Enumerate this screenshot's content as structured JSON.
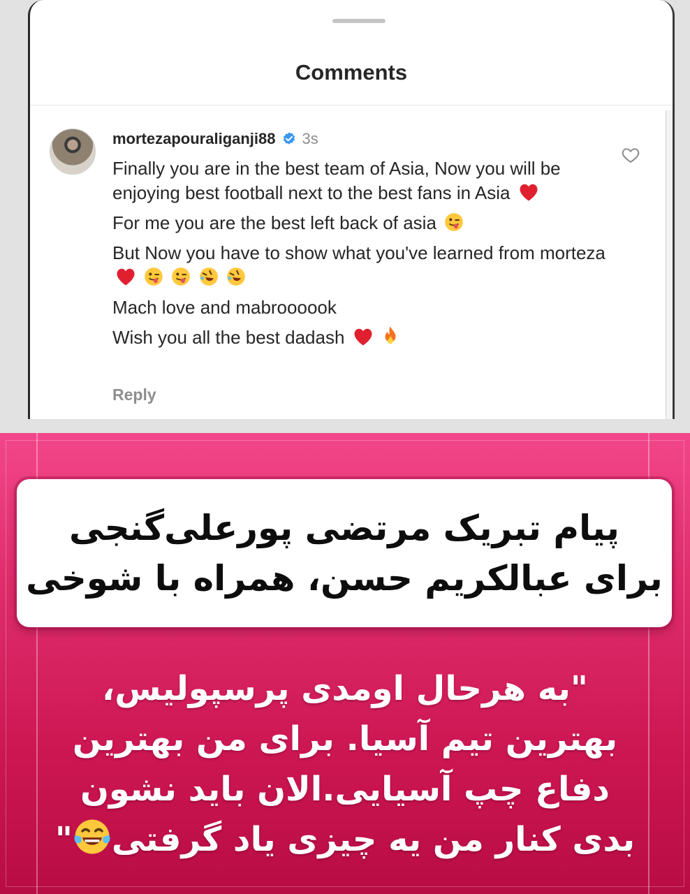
{
  "sheet": {
    "title": "Comments"
  },
  "comment": {
    "username": "mortezapouraliganji88",
    "time": "3s",
    "paragraphs": [
      "Finally you are in the best team of Asia, Now you will be enjoying best football next to the best fans in Asia",
      "For me you are the best left back of asia",
      "But Now you have to show what you've learned from morteza",
      "Mach love and mabroooook",
      "Wish you all the best  dadash"
    ],
    "reply_label": "Reply"
  },
  "headline": {
    "line1": "پیام تبریک مرتضی پورعلی‌گنجی",
    "line2": "برای عبالکریم حسن، همراه با شوخی"
  },
  "quote": {
    "line1": "\"به هرحال اومدی پرسپولیس،",
    "line2": "بهترین تیم آسیا. برای من بهترین",
    "line3": "دفاع چپ آسیایی.الان باید نشون",
    "line4": "بدی کنار من یه چیزی یاد گرفتی",
    "line4_end": "\""
  },
  "icons": {
    "verified": "verified-badge-icon",
    "like": "heart-outline-icon",
    "emoji_heart": "red-heart-emoji",
    "emoji_wink": "winking-tongue-emoji",
    "emoji_rofl": "rolling-laughing-emoji",
    "emoji_fire": "fire-emoji",
    "emoji_tears": "tears-of-joy-emoji"
  },
  "colors": {
    "verified_blue": "#3897f0",
    "pink_top": "#f2468a",
    "pink_bottom": "#b80c44",
    "heart_red": "#e0202e"
  }
}
